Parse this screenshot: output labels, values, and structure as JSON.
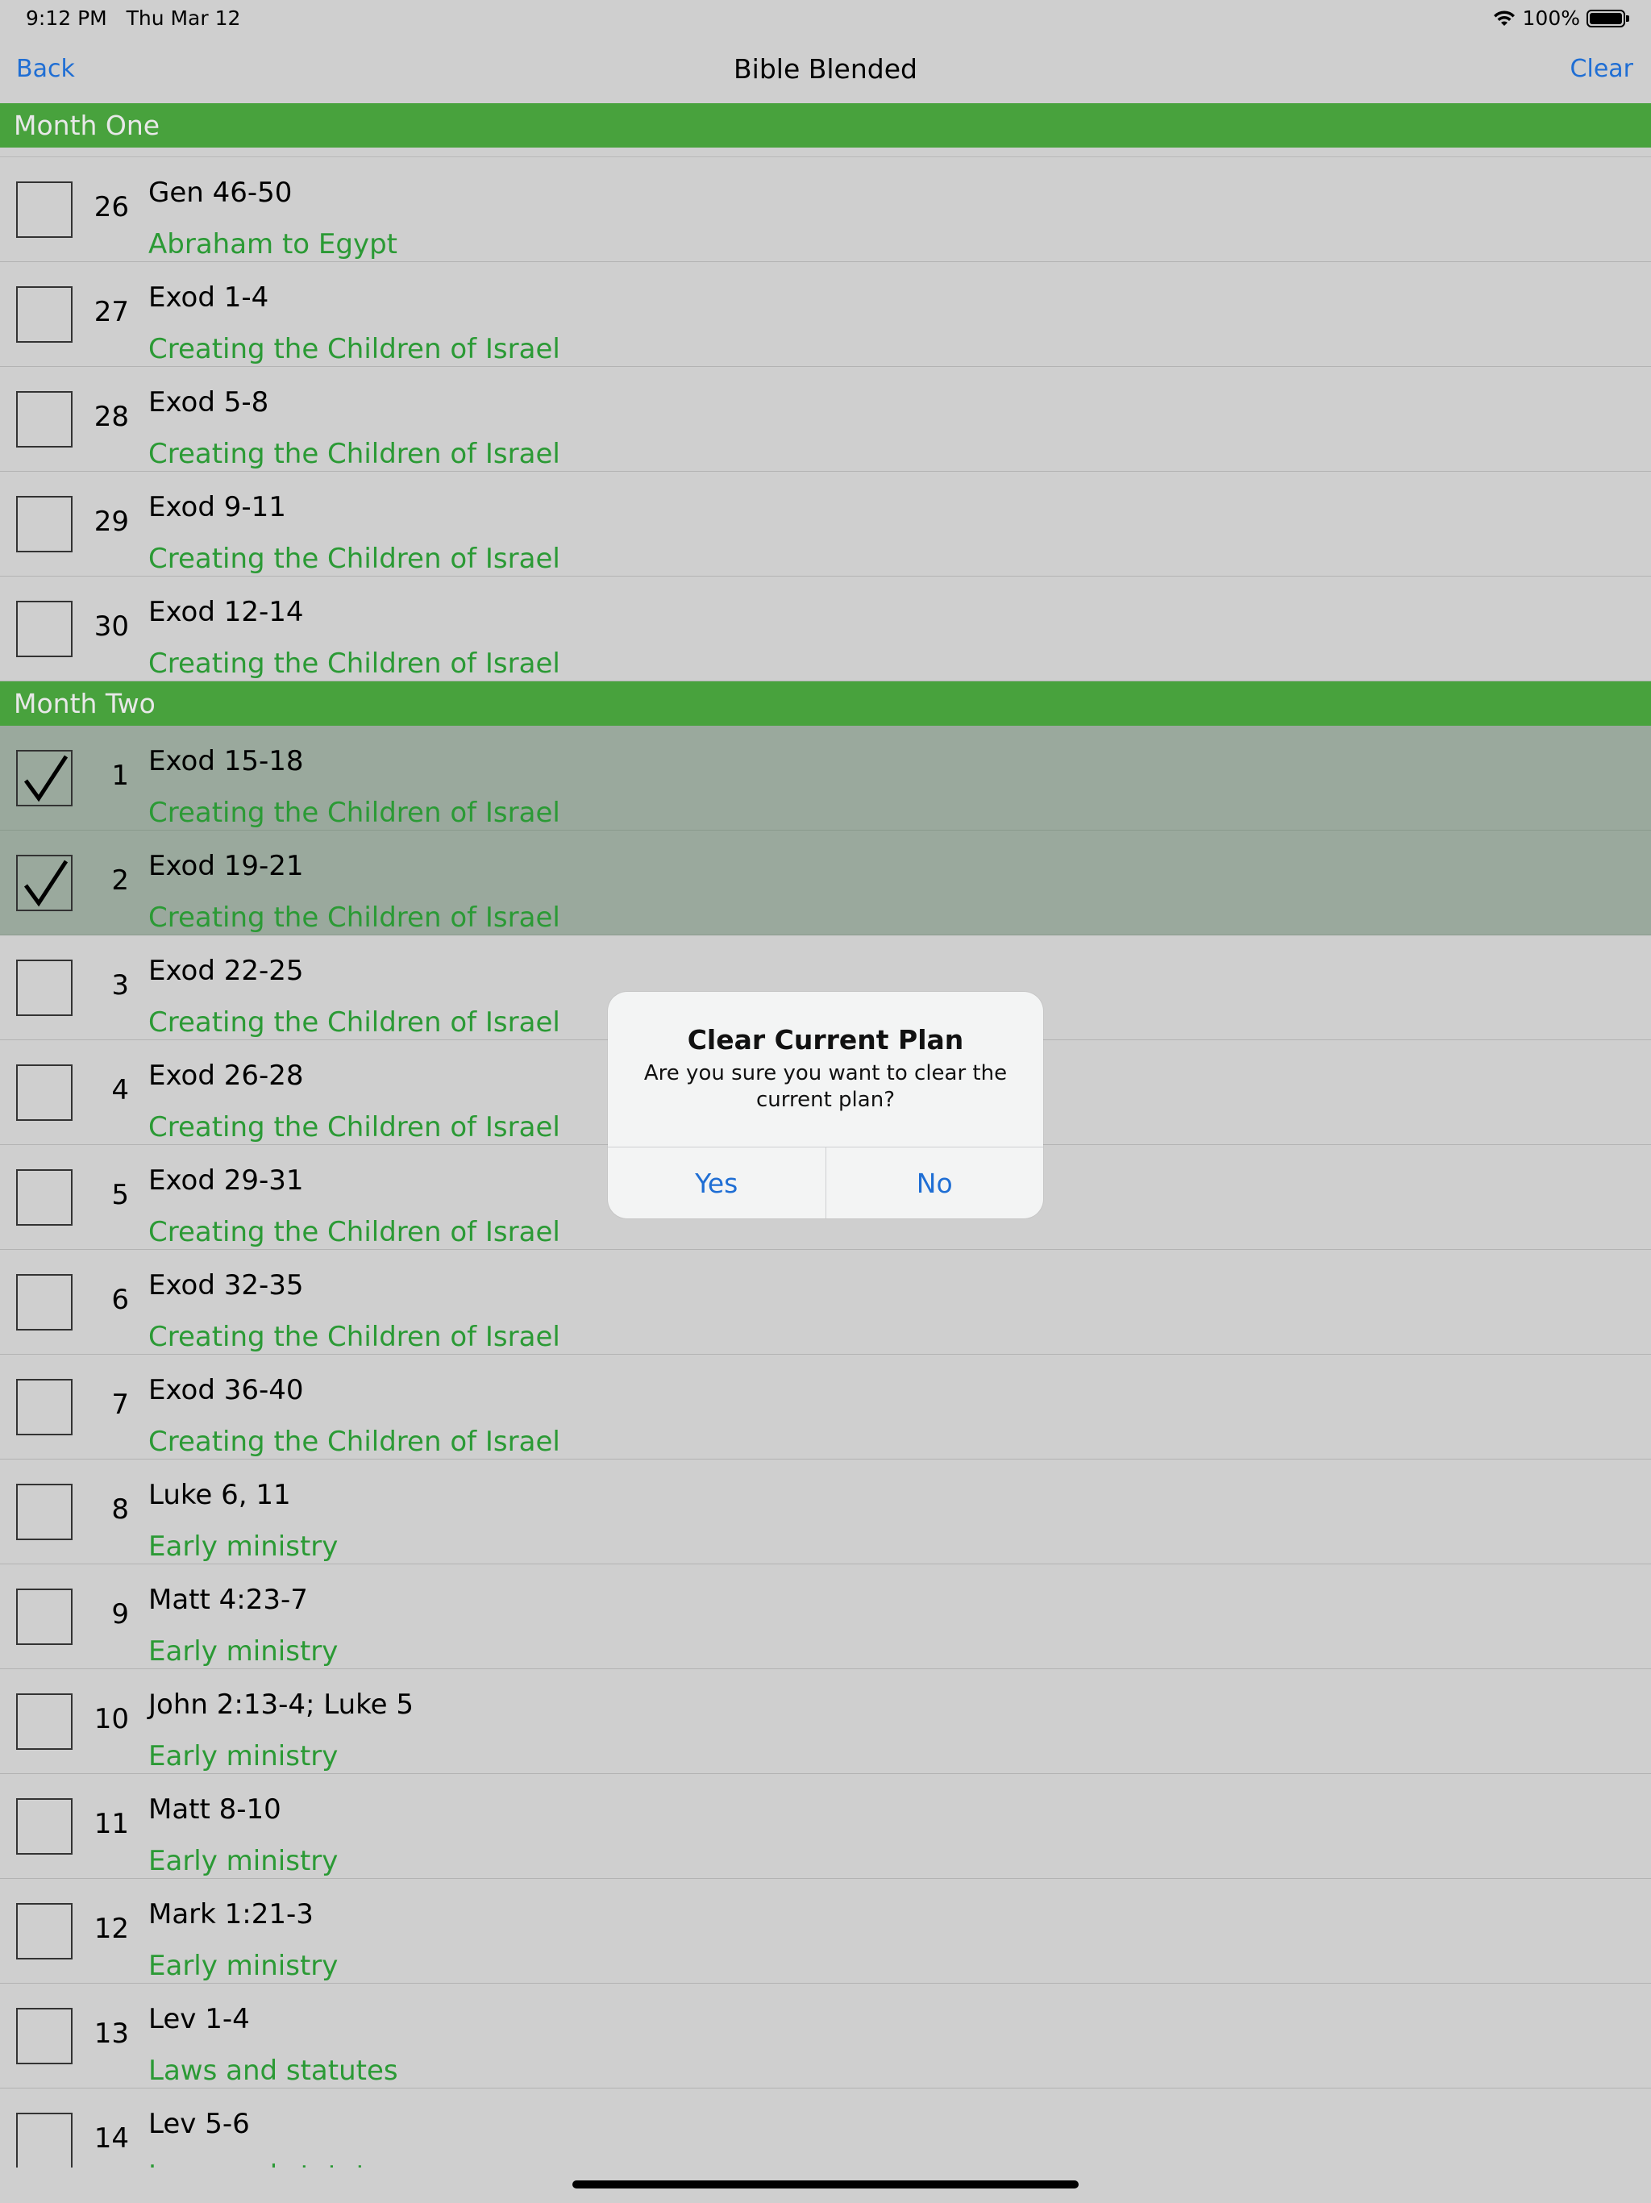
{
  "status": {
    "time": "9:12 PM",
    "date": "Thu Mar 12",
    "battery": "100%"
  },
  "nav": {
    "back_label": "Back",
    "title": "Bible Blended",
    "clear_label": "Clear"
  },
  "sections": [
    {
      "title": "Month One",
      "rows": [
        {
          "day": "26",
          "passage": "Gen 46-50",
          "theme": "Abraham to Egypt",
          "checked": false
        },
        {
          "day": "27",
          "passage": "Exod 1-4",
          "theme": "Creating the Children of Israel",
          "checked": false
        },
        {
          "day": "28",
          "passage": "Exod 5-8",
          "theme": "Creating the Children of Israel",
          "checked": false
        },
        {
          "day": "29",
          "passage": "Exod 9-11",
          "theme": "Creating the Children of Israel",
          "checked": false
        },
        {
          "day": "30",
          "passage": "Exod 12-14",
          "theme": "Creating the Children of Israel",
          "checked": false
        }
      ]
    },
    {
      "title": "Month Two",
      "rows": [
        {
          "day": "1",
          "passage": "Exod 15-18",
          "theme": "Creating the Children of Israel",
          "checked": true
        },
        {
          "day": "2",
          "passage": "Exod 19-21",
          "theme": "Creating the Children of Israel",
          "checked": true
        },
        {
          "day": "3",
          "passage": "Exod 22-25",
          "theme": "Creating the Children of Israel",
          "checked": false
        },
        {
          "day": "4",
          "passage": "Exod 26-28",
          "theme": "Creating the Children of Israel",
          "checked": false
        },
        {
          "day": "5",
          "passage": "Exod 29-31",
          "theme": "Creating the Children of Israel",
          "checked": false
        },
        {
          "day": "6",
          "passage": "Exod 32-35",
          "theme": "Creating the Children of Israel",
          "checked": false
        },
        {
          "day": "7",
          "passage": "Exod 36-40",
          "theme": "Creating the Children of Israel",
          "checked": false
        },
        {
          "day": "8",
          "passage": "Luke 6, 11",
          "theme": "Early ministry",
          "checked": false
        },
        {
          "day": "9",
          "passage": "Matt 4:23-7",
          "theme": "Early ministry",
          "checked": false
        },
        {
          "day": "10",
          "passage": "John 2:13-4; Luke 5",
          "theme": "Early ministry",
          "checked": false
        },
        {
          "day": "11",
          "passage": "Matt 8-10",
          "theme": "Early ministry",
          "checked": false
        },
        {
          "day": "12",
          "passage": "Mark 1:21-3",
          "theme": "Early ministry",
          "checked": false
        },
        {
          "day": "13",
          "passage": "Lev 1-4",
          "theme": "Laws and statutes",
          "checked": false
        },
        {
          "day": "14",
          "passage": "Lev 5-6",
          "theme": "Laws and statutes",
          "checked": false
        }
      ]
    }
  ],
  "alert": {
    "title": "Clear Current Plan",
    "message": "Are you sure you want to clear the current plan?",
    "yes_label": "Yes",
    "no_label": "No"
  },
  "colors": {
    "accent": "#1f6ed4",
    "section": "#48a23d",
    "theme_text": "#2b9a35",
    "checked_row": "#9aa99d"
  },
  "icons": {
    "wifi": "wifi-icon",
    "battery": "battery-icon",
    "check": "checkmark-icon"
  }
}
